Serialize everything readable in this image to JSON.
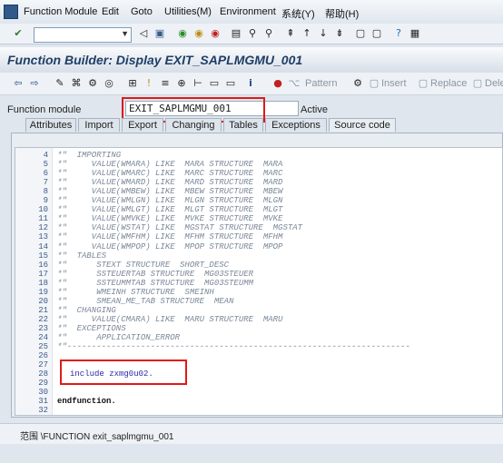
{
  "menu": [
    "Function Module",
    "Edit",
    "Goto",
    "Utilities(M)",
    "Environment",
    "系统(Y)",
    "帮助(H)"
  ],
  "title": "Function Builder: Display EXIT_SAPLMGMU_001",
  "app_toolbar": {
    "pattern": "Pattern",
    "insert": "Insert",
    "replace": "Replace",
    "delete": "Dele"
  },
  "function_module": {
    "label": "Function module",
    "value": "EXIT_SAPLMGMU_001",
    "status": "Active"
  },
  "tabs": [
    "Attributes",
    "Import",
    "Export",
    "Changing",
    "Tables",
    "Exceptions",
    "Source code"
  ],
  "code": [
    {
      "n": "4",
      "t": "*\"  IMPORTING",
      "c": "comment"
    },
    {
      "n": "5",
      "t": "*\"     VALUE(WMARA) LIKE  MARA STRUCTURE  MARA",
      "c": "comment"
    },
    {
      "n": "6",
      "t": "*\"     VALUE(WMARC) LIKE  MARC STRUCTURE  MARC",
      "c": "comment"
    },
    {
      "n": "7",
      "t": "*\"     VALUE(WMARD) LIKE  MARD STRUCTURE  MARD",
      "c": "comment"
    },
    {
      "n": "8",
      "t": "*\"     VALUE(WMBEW) LIKE  MBEW STRUCTURE  MBEW",
      "c": "comment"
    },
    {
      "n": "9",
      "t": "*\"     VALUE(WMLGN) LIKE  MLGN STRUCTURE  MLGN",
      "c": "comment"
    },
    {
      "n": "10",
      "t": "*\"     VALUE(WMLGT) LIKE  MLGT STRUCTURE  MLGT",
      "c": "comment"
    },
    {
      "n": "11",
      "t": "*\"     VALUE(WMVKE) LIKE  MVKE STRUCTURE  MVKE",
      "c": "comment"
    },
    {
      "n": "12",
      "t": "*\"     VALUE(WSTAT) LIKE  MGSTAT STRUCTURE  MGSTAT",
      "c": "comment"
    },
    {
      "n": "13",
      "t": "*\"     VALUE(WMFHM) LIKE  MFHM STRUCTURE  MFHM",
      "c": "comment"
    },
    {
      "n": "14",
      "t": "*\"     VALUE(WMPOP) LIKE  MPOP STRUCTURE  MPOP",
      "c": "comment"
    },
    {
      "n": "15",
      "t": "*\"  TABLES",
      "c": "comment"
    },
    {
      "n": "16",
      "t": "*\"      STEXT STRUCTURE  SHORT_DESC",
      "c": "comment"
    },
    {
      "n": "17",
      "t": "*\"      SSTEUERTAB STRUCTURE  MG03STEUER",
      "c": "comment"
    },
    {
      "n": "18",
      "t": "*\"      SSTEUMMTAB STRUCTURE  MG03STEUMM",
      "c": "comment"
    },
    {
      "n": "19",
      "t": "*\"      WMEINH STRUCTURE  SMEINH",
      "c": "comment"
    },
    {
      "n": "20",
      "t": "*\"      SMEAN_ME_TAB STRUCTURE  MEAN",
      "c": "comment"
    },
    {
      "n": "21",
      "t": "*\"  CHANGING",
      "c": "comment"
    },
    {
      "n": "22",
      "t": "*\"     VALUE(CMARA) LIKE  MARU STRUCTURE  MARU",
      "c": "comment"
    },
    {
      "n": "23",
      "t": "*\"  EXCEPTIONS",
      "c": "comment"
    },
    {
      "n": "24",
      "t": "*\"      APPLICATION_ERROR",
      "c": "comment"
    },
    {
      "n": "25",
      "t": "*\"----------------------------------------------------------------------",
      "c": "comment"
    },
    {
      "n": "26",
      "t": "",
      "c": "plain"
    },
    {
      "n": "27",
      "t": "",
      "c": "plain"
    },
    {
      "n": "28",
      "t": "include zxmg0u02.",
      "c": "include"
    },
    {
      "n": "29",
      "t": "",
      "c": "plain"
    },
    {
      "n": "30",
      "t": "",
      "c": "plain"
    },
    {
      "n": "31",
      "t": "endfunction.",
      "c": "bold"
    },
    {
      "n": "32",
      "t": "",
      "c": "plain"
    }
  ],
  "status_scope": "范围 \\FUNCTION exit_saplmgmu_001"
}
